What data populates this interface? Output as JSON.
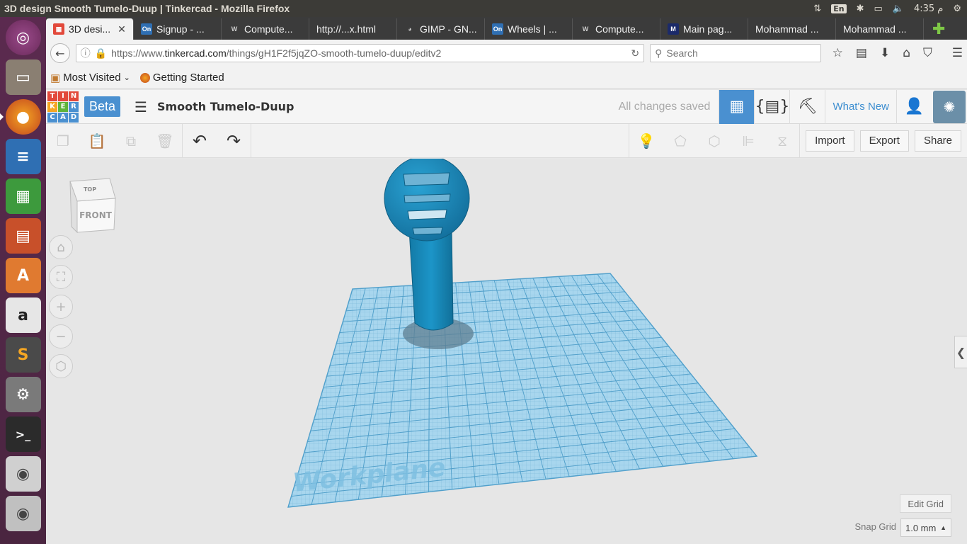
{
  "topbar": {
    "window_title": "3D design Smooth Tumelo-Duup | Tinkercad - Mozilla Firefox",
    "keyboard_lang": "En",
    "clock": "4:35 م"
  },
  "launcher": {
    "apps": [
      "ubuntu-dash",
      "files",
      "firefox",
      "writer",
      "calc",
      "impress",
      "software-center",
      "amazon",
      "sublime-text",
      "system-settings",
      "terminal",
      "camera",
      "scanner"
    ]
  },
  "tabs": [
    {
      "label": "3D desi...",
      "icon": "tinkercad-icon"
    },
    {
      "label": "Signup - ...",
      "icon": "on-icon"
    },
    {
      "label": "Compute...",
      "icon": "wiki-icon"
    },
    {
      "label": "http://...x.html",
      "icon": ""
    },
    {
      "label": "GIMP - GN...",
      "icon": "gimp-icon"
    },
    {
      "label": "Wheels | ...",
      "icon": "on-icon"
    },
    {
      "label": "Compute...",
      "icon": "wiki-icon"
    },
    {
      "label": "Main pag...",
      "icon": "m-icon"
    },
    {
      "label": "Mohammad ...",
      "icon": ""
    },
    {
      "label": "Mohammad ...",
      "icon": ""
    }
  ],
  "nav": {
    "url_prefix": "https://www.",
    "url_domain": "tinkercad.com",
    "url_path": "/things/gH1F2f5jqZO-smooth-tumelo-duup/editv2",
    "search_placeholder": "Search"
  },
  "bookmarks": {
    "most_visited": "Most Visited",
    "getting_started": "Getting Started"
  },
  "tinkercad": {
    "logo_letters": [
      "T",
      "I",
      "N",
      "K",
      "E",
      "R",
      "C",
      "A",
      "D"
    ],
    "logo_colors": [
      "#e2493b",
      "#e2493b",
      "#e2493b",
      "#f5a623",
      "#5fb43a",
      "#4a90d0",
      "#4a90d0",
      "#4a90d0",
      "#4a90d0"
    ],
    "beta": "Beta",
    "project_name": "Smooth Tumelo-Duup",
    "save_status": "All changes saved",
    "whats_new": "What's New"
  },
  "toolbar": {
    "import": "Import",
    "export": "Export",
    "share": "Share"
  },
  "viewport": {
    "cube_top": "TOP",
    "cube_front": "FRONT",
    "workplane_label": "Workplane",
    "edit_grid": "Edit Grid",
    "snap_grid_label": "Snap Grid",
    "snap_grid_value": "1.0 mm"
  },
  "colors": {
    "accent": "#4a90d0",
    "model": "#1c8dbf",
    "workplane": "#8fc8e6"
  }
}
